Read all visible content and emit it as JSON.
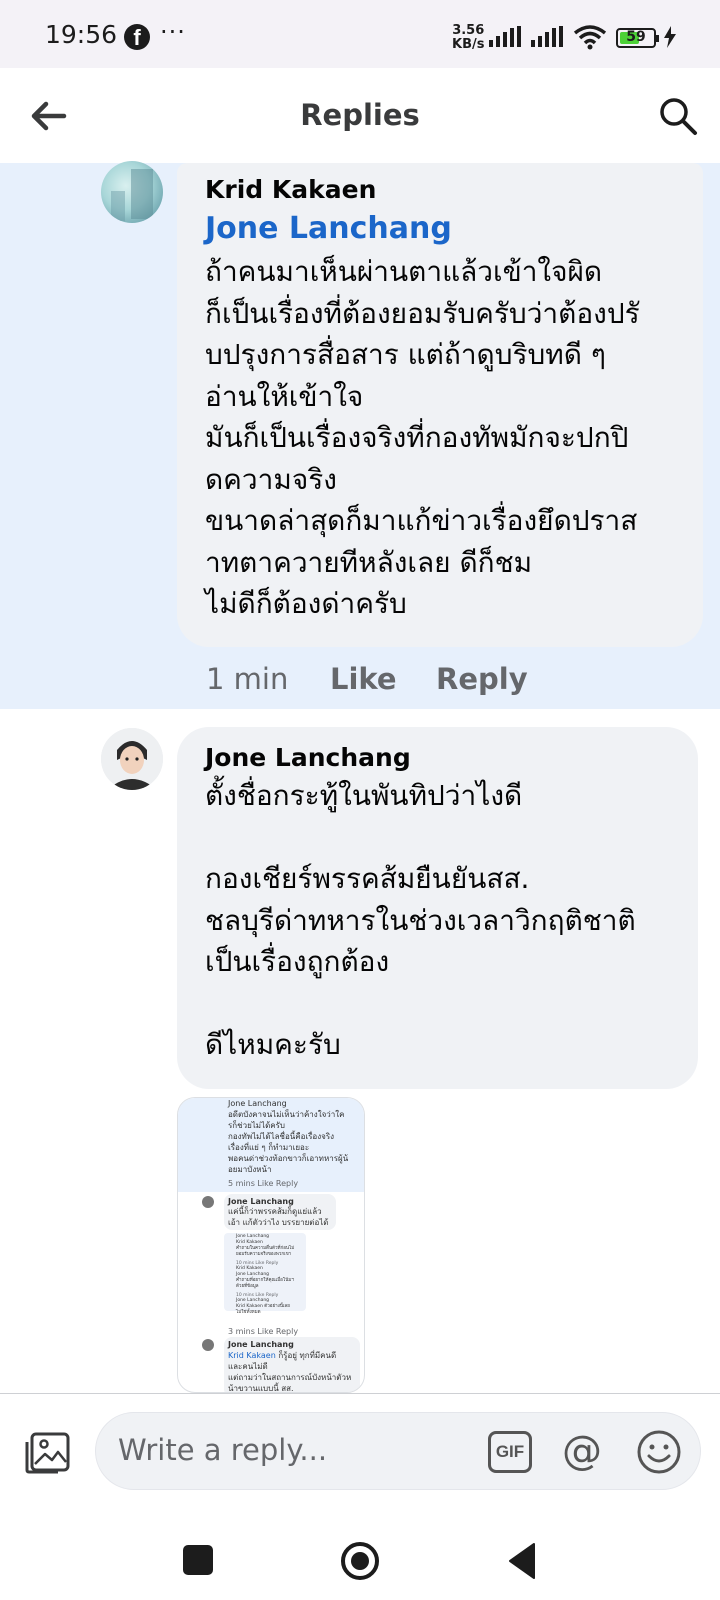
{
  "status_bar": {
    "time": "19:56",
    "app_icon": "facebook-icon",
    "more": "···",
    "net_speed_value": "3.56",
    "net_speed_unit": "KB/s",
    "battery_level": "59",
    "battery_fraction": 0.59,
    "battery_color": "#4cd137"
  },
  "header": {
    "title": "Replies",
    "back_icon": "arrow-left-icon",
    "search_icon": "search-icon"
  },
  "comments": [
    {
      "author": "Krid Kakaen",
      "mention": "Jone Lanchang",
      "lines": "ถ้าคนมาเห็นผ่านตาแล้วเข้าใจผิด\nก็เป็นเรื่องที่ต้องยอมรับครับว่าต้องปรั\nบปรุงการสื่อสาร แต่ถ้าดูบริบทดี ๆ\nอ่านให้เข้าใจ\nมันก็เป็นเรื่องจริงที่กองทัพมักจะปกปิ\nดความจริง\nขนาดล่าสุดก็มาแก้ข่าวเรื่องยึดปราส\nาทตาควายทีหลังเลย ดีก็ชม\nไม่ดีก็ต้องด่าครับ",
      "time": "1 min",
      "like": "Like",
      "reply": "Reply",
      "highlight_color": "#e7f0fc"
    },
    {
      "author": "Jone Lanchang",
      "lines": "ตั้งชื่อกระทู้ในพันทิปว่าไงดี\n\nกองเชียร์พรรคส้มยืนยันสส.\nชลบุรีด่าทหารในช่วงเวลาวิกฤติชาติ\nเป็นเรื่องถูกต้อง\n\nดีไหมคะรับ"
    }
  ],
  "attachment": {
    "top_text": "Jone Lanchang\nอดีตบังคาจนไม่เห็นว่าค้างใจว่าใค\nรก็ช่วยไม่ได้ครับ\nกองทัพไม่ได้ไลชื่อนี้คือเรื่องจริง\nเรื่องที่แย่ ๆ ก็ทำมาเยอะ\nพอคนด่าช่วงท้อกขาวก็เอาทหารผู้น้\nอยมาบังหน้า",
    "top_meta": "5 mins   Like   Reply",
    "mid_author": "Jone Lanchang",
    "mid_text": "แค่นี้ก็ว่าพรรคส้มก็ดูแย่แล้ว\nเอ้า แก้ตัวว่าไง บรรยายต่อได้",
    "nested_1": "Jone Lanchang\nKrid Kakaen\nคำถามในความตื่นตัวที่ก่อนไม่\nยอมรับความจริงของพวกเขา",
    "nested_1_meta": "10 mins   Like   Reply",
    "nested_2": "Krid Kakaen\nJone Lanchang\nคำถามที่อยากให้คุณเมื่อโน้มฯ\nด้วยที่ข้อมูล",
    "nested_2_meta": "10 mins   Like   Reply",
    "nested_3": "Jone Lanchang\nKrid Kakaen ตัวอย่างนี้เลย\nไม่ใช่ทั้งหมด",
    "mid_meta": "3 mins   Like   Reply",
    "bottom_author": "Jone Lanchang",
    "bottom_mention": "Krid Kakaen",
    "bottom_text": " ก็รู้อยู่ ทุกที่มีคนดี\nและคนไม่ดี\nแต่ถามว่าในสถานการณ์บังหน้าตัวห\nน้าขวานแบบนี้ สส."
  },
  "compose": {
    "placeholder": "Write a reply...",
    "gif_label": "GIF",
    "at_label": "@",
    "photo_icon": "photo-icon",
    "emoji_icon": "emoji-icon"
  },
  "nav": {
    "recents_icon": "square-icon",
    "home_icon": "home-circle-icon",
    "back_icon": "triangle-back-icon"
  }
}
